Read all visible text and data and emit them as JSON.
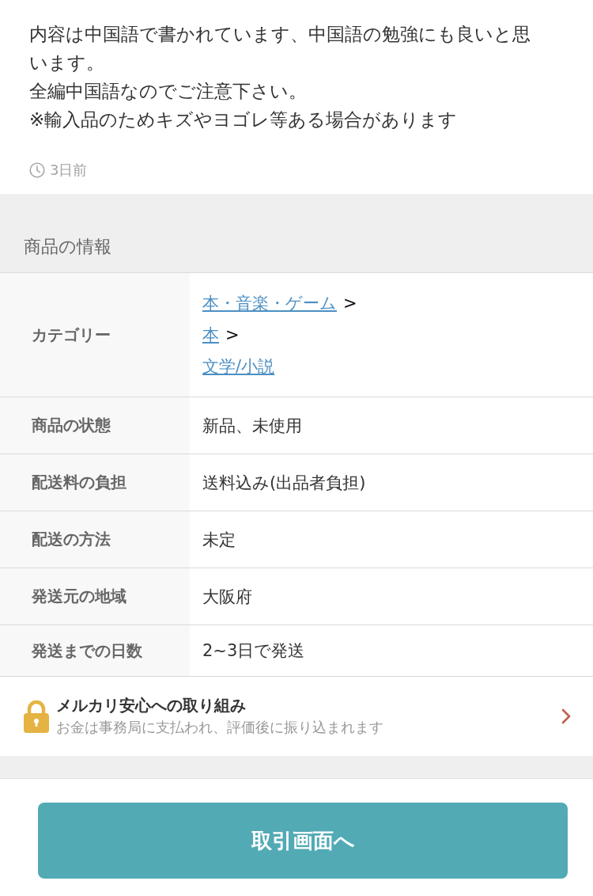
{
  "description": {
    "paragraphs": [
      "内容は中国語で書かれています、中国語の勉強にも良いと思います。",
      "全編中国語なのでご注意下さい。",
      "※輸入品のためキズやヨゴレ等ある場合があります"
    ],
    "posted": "3日前"
  },
  "item_info": {
    "title": "商品の情報",
    "rows": [
      {
        "kind": "links",
        "label": "カテゴリー",
        "value_lines": [
          {
            "link": "本・音楽・ゲーム",
            "separator": ">"
          },
          {
            "link": "本",
            "separator": ">"
          },
          {
            "link": "文学/小説"
          }
        ]
      },
      {
        "kind": "text",
        "label": "商品の状態",
        "value": "新品、未使用"
      },
      {
        "kind": "text",
        "label": "配送料の負担",
        "value": "送料込み(出品者負担)"
      },
      {
        "kind": "text",
        "label": "配送の方法",
        "value": "未定"
      },
      {
        "kind": "text",
        "label": "発送元の地域",
        "value": "大阪府"
      },
      {
        "kind": "text",
        "label": "発送までの日数",
        "value": "2~3日で発送"
      }
    ]
  },
  "safety_banner": {
    "title": "メルカリ安心への取り組み",
    "description": "お金は事務局に支払われ、評価後に振り込まれます"
  },
  "action_button": {
    "label": "取引画面へ"
  }
}
